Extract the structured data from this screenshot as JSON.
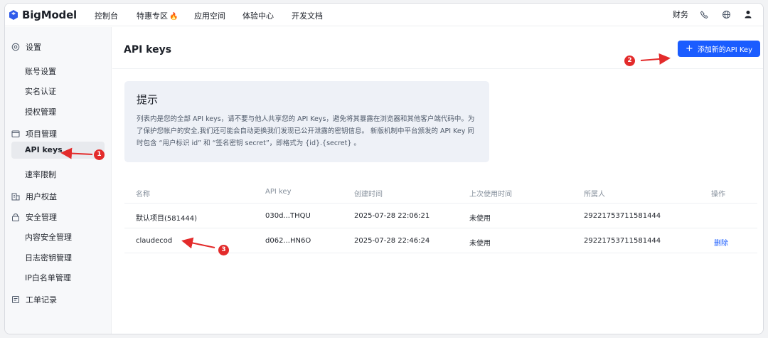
{
  "app": {
    "logo_text": "BigModel"
  },
  "topnav": {
    "items": [
      "控制台",
      "特惠专区",
      "应用空间",
      "体验中心",
      "开发文档"
    ],
    "finance": "财务"
  },
  "sidebar": {
    "settings": "设置",
    "account_settings": "账号设置",
    "real_name": "实名认证",
    "auth_manage": "授权管理",
    "project_manage": "项目管理",
    "api_keys": "API keys",
    "rate_limit": "速率限制",
    "user_rights": "用户权益",
    "security_manage": "安全管理",
    "content_security": "内容安全管理",
    "log_key_manage": "日志密钥管理",
    "ip_whitelist": "IP白名单管理",
    "tickets": "工单记录"
  },
  "main": {
    "title": "API keys",
    "add_button": "添加新的API Key"
  },
  "tip": {
    "title": "提示",
    "body": "列表内是您的全部 API keys，请不要与他人共享您的 API Keys，避免将其暴露在浏览器和其他客户端代码中。为了保护您帐户的安全,我们还可能会自动更换我们发现已公开泄露的密钥信息。 新版机制中平台颁发的 API Key 同时包含 “用户标识 id” 和 “签名密钥 secret”，即格式为 {id}.{secret} 。"
  },
  "table": {
    "headers": [
      "名称",
      "API key",
      "创建时间",
      "上次使用时间",
      "所属人",
      "操作"
    ],
    "rows": [
      {
        "name": "默认项目(581444)",
        "key": "030d...THQU",
        "created": "2025-07-28 22:06:21",
        "last_used": "未使用",
        "owner": "29221753711581444",
        "action": ""
      },
      {
        "name": "claudecod",
        "key": "d062...HN6O",
        "created": "2025-07-28 22:46:24",
        "last_used": "未使用",
        "owner": "29221753711581444",
        "action": "删除"
      }
    ]
  },
  "annotations": [
    "1",
    "2",
    "3"
  ],
  "colors": {
    "primary": "#1a5cff",
    "annotation": "#e32b2b"
  }
}
